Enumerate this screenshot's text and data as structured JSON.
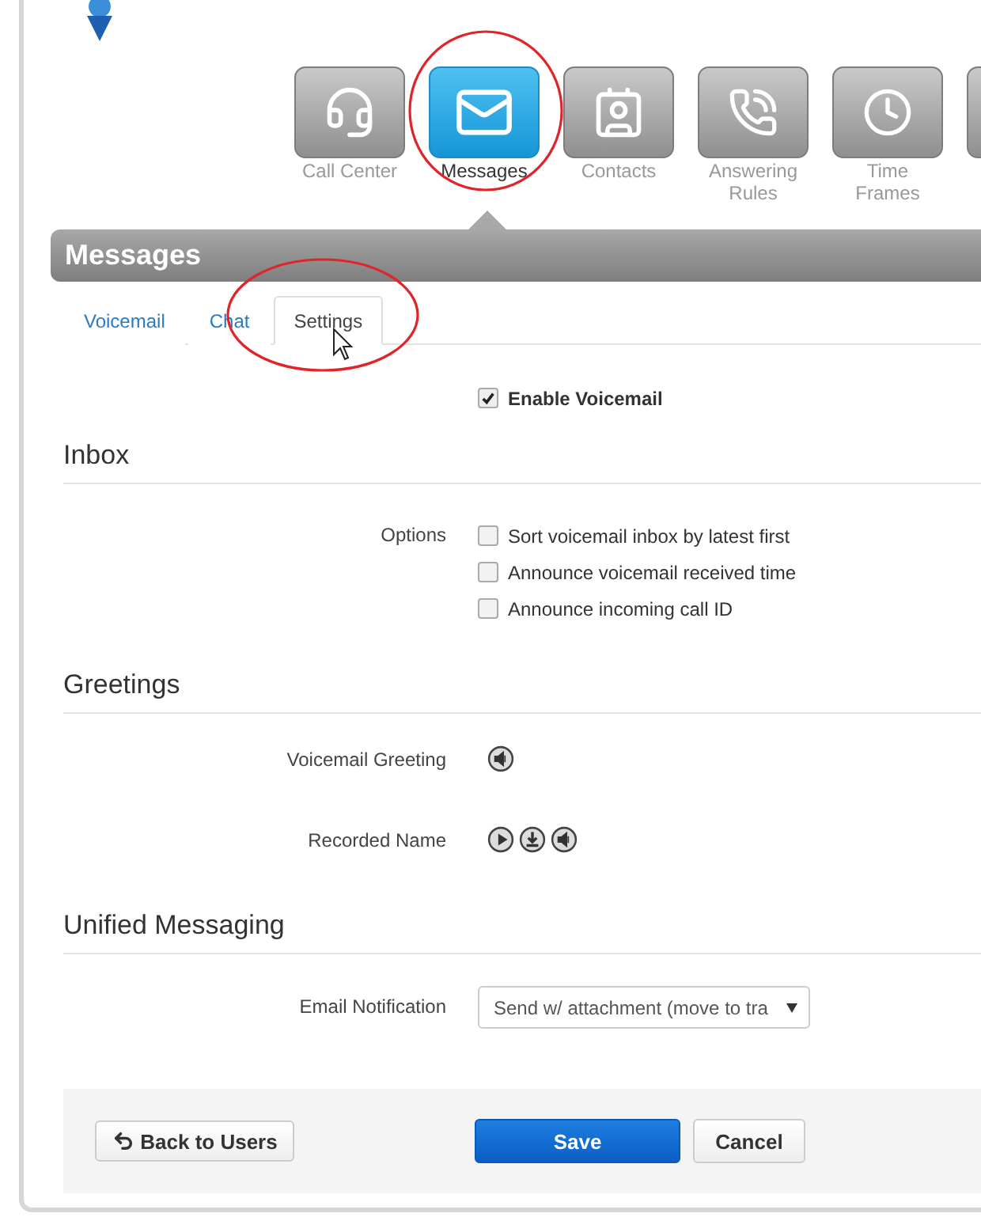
{
  "nav": [
    {
      "label": "Call Center",
      "kind": "headset",
      "selected": false
    },
    {
      "label": "Messages",
      "kind": "mail",
      "selected": true
    },
    {
      "label": "Contacts",
      "kind": "contact",
      "selected": false
    },
    {
      "label": "Answering Rules",
      "kind": "phone",
      "selected": false
    },
    {
      "label": "Time Frames",
      "kind": "clock",
      "selected": false
    },
    {
      "kind": "partial",
      "selected": false
    }
  ],
  "title": "Messages",
  "tabs": [
    {
      "label": "Voicemail",
      "selected": false
    },
    {
      "label": "Chat",
      "selected": false
    },
    {
      "label": "Settings",
      "selected": true
    }
  ],
  "enable_voicemail": {
    "label": "Enable Voicemail",
    "checked": true
  },
  "inbox": {
    "heading": "Inbox",
    "label": "Options",
    "options": [
      {
        "label": "Sort voicemail inbox by latest first",
        "checked": false
      },
      {
        "label": "Announce voicemail received time",
        "checked": false
      },
      {
        "label": "Announce incoming call ID",
        "checked": false
      }
    ]
  },
  "greetings": {
    "heading": "Greetings",
    "rows": [
      {
        "label": "Voicemail Greeting",
        "controls": [
          {
            "kind": "speaker"
          }
        ]
      },
      {
        "label": "Recorded Name",
        "controls": [
          {
            "kind": "play"
          },
          {
            "kind": "download"
          },
          {
            "kind": "speaker"
          }
        ]
      }
    ]
  },
  "unified_messaging": {
    "heading": "Unified Messaging",
    "label": "Email Notification",
    "value": "Send w/ attachment (move to tra"
  },
  "footer": {
    "back": "Back to Users",
    "save": "Save",
    "cancel": "Cancel"
  }
}
